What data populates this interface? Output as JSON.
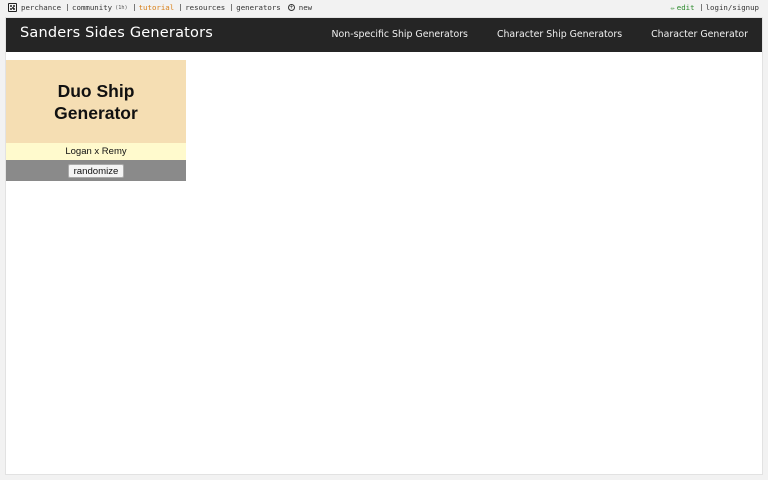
{
  "topbar": {
    "left": [
      {
        "label": "perchance"
      },
      {
        "label": "community",
        "badge": "(1h)"
      },
      {
        "label": "tutorial"
      },
      {
        "label": "resources"
      },
      {
        "label": "generators"
      },
      {
        "label": "new"
      }
    ],
    "right": [
      {
        "label": "edit"
      },
      {
        "label": "login/signup"
      }
    ],
    "colors": {
      "tutorial": "#d8801a",
      "edit": "#2c8a2c"
    }
  },
  "navbar": {
    "brand": "Sanders Sides Generators",
    "links": [
      "Non-specific Ship Generators",
      "Character Ship Generators",
      "Character Generator"
    ]
  },
  "generator": {
    "title": "Duo Ship Generator",
    "output": "Logan x Remy",
    "button_label": "randomize",
    "colors": {
      "header": "#f5deb3",
      "output": "#fffacd",
      "footer": "#8a8a8a"
    }
  }
}
